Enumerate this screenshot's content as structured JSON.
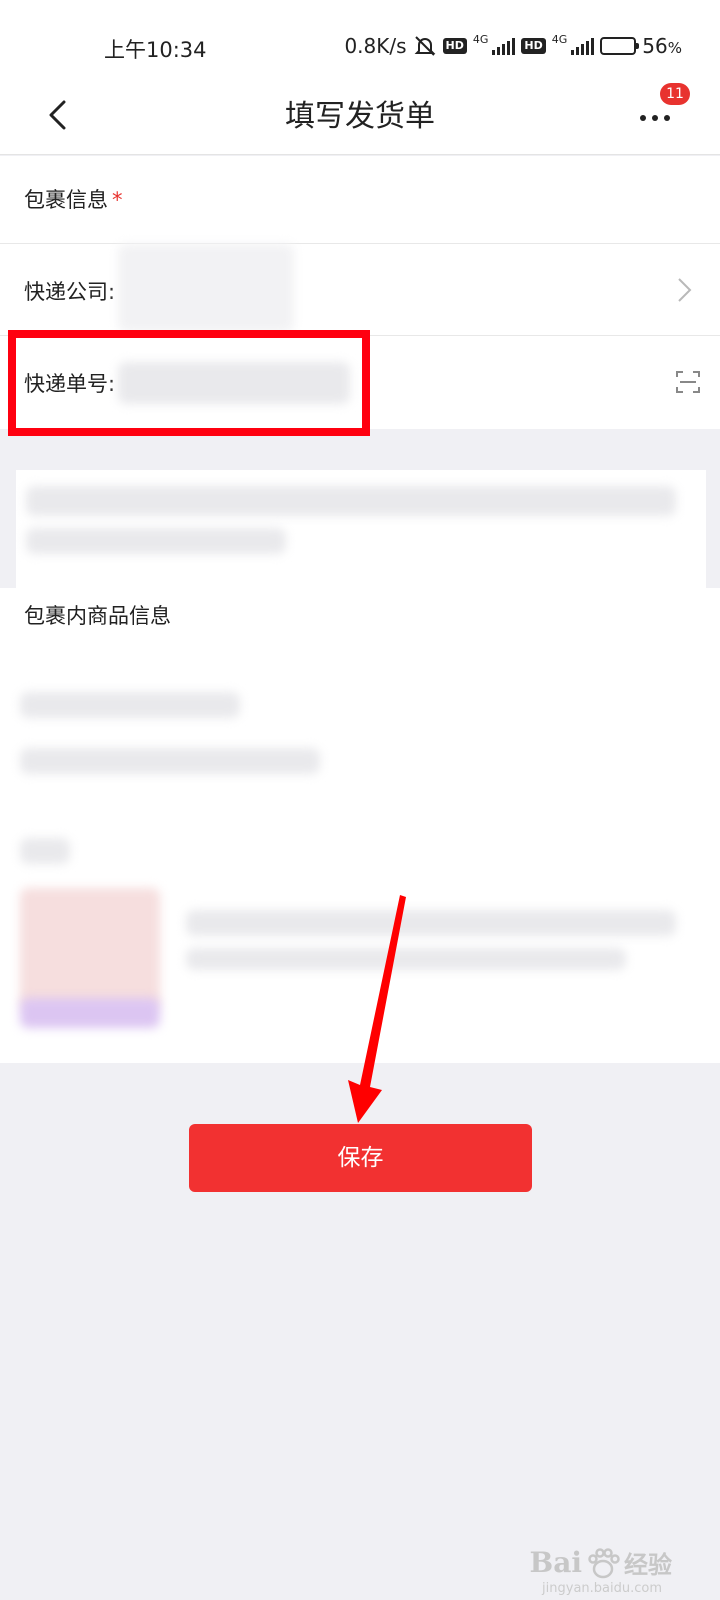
{
  "status_bar": {
    "time": "上午10:34",
    "net_speed": "0.8K/s",
    "hd_label": "HD",
    "network_label": "4G",
    "battery": "56",
    "battery_unit": "%",
    "battery_level": 0.56,
    "mute_icon": "bell-muted-icon"
  },
  "nav": {
    "back_icon": "chevron-left-icon",
    "title": "填写发货单",
    "more_icon": "more-dots-icon",
    "badge": "11"
  },
  "package_info": {
    "header": "包裹信息",
    "required_mark": "*",
    "courier_label": "快递公司:",
    "courier_chevron_icon": "chevron-right-icon",
    "tracking_label": "快递单号:",
    "scan_icon": "scan-icon"
  },
  "goods": {
    "header": "包裹内商品信息"
  },
  "actions": {
    "save_label": "保存"
  },
  "watermark": {
    "brand": "Bai",
    "brand_right": "经验",
    "sub": "jingyan.baidu.com"
  },
  "colors": {
    "accent": "#f23131",
    "highlight": "#ff0010",
    "background": "#f0f0f4"
  }
}
